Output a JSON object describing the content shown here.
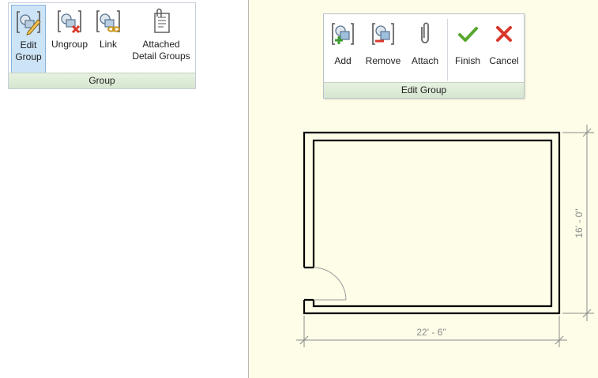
{
  "group_panel": {
    "title": "Group",
    "buttons": [
      {
        "label": "Edit\nGroup",
        "icon": "edit-group-icon",
        "active": true
      },
      {
        "label": "Ungroup",
        "icon": "ungroup-icon"
      },
      {
        "label": "Link",
        "icon": "link-icon"
      },
      {
        "label": "Attached\nDetail Groups",
        "icon": "attached-detail-groups-icon"
      }
    ]
  },
  "edit_group_toolbar": {
    "title": "Edit Group",
    "buttons": [
      {
        "label": "Add",
        "icon": "add-to-group-icon"
      },
      {
        "label": "Remove",
        "icon": "remove-from-group-icon"
      },
      {
        "label": "Attach",
        "icon": "attach-paperclip-icon"
      },
      {
        "label": "Finish",
        "icon": "checkmark-icon"
      },
      {
        "label": "Cancel",
        "icon": "cancel-x-icon"
      }
    ]
  },
  "drawing": {
    "dimensions": {
      "width": "22' - 6\"",
      "height": "16' - 0\""
    }
  },
  "colors": {
    "canvas": "#fefde8",
    "active_button": "#cde4f7",
    "footer_green": "#d6e6cf",
    "finish_green": "#5aa832",
    "cancel_red": "#d9382c"
  }
}
